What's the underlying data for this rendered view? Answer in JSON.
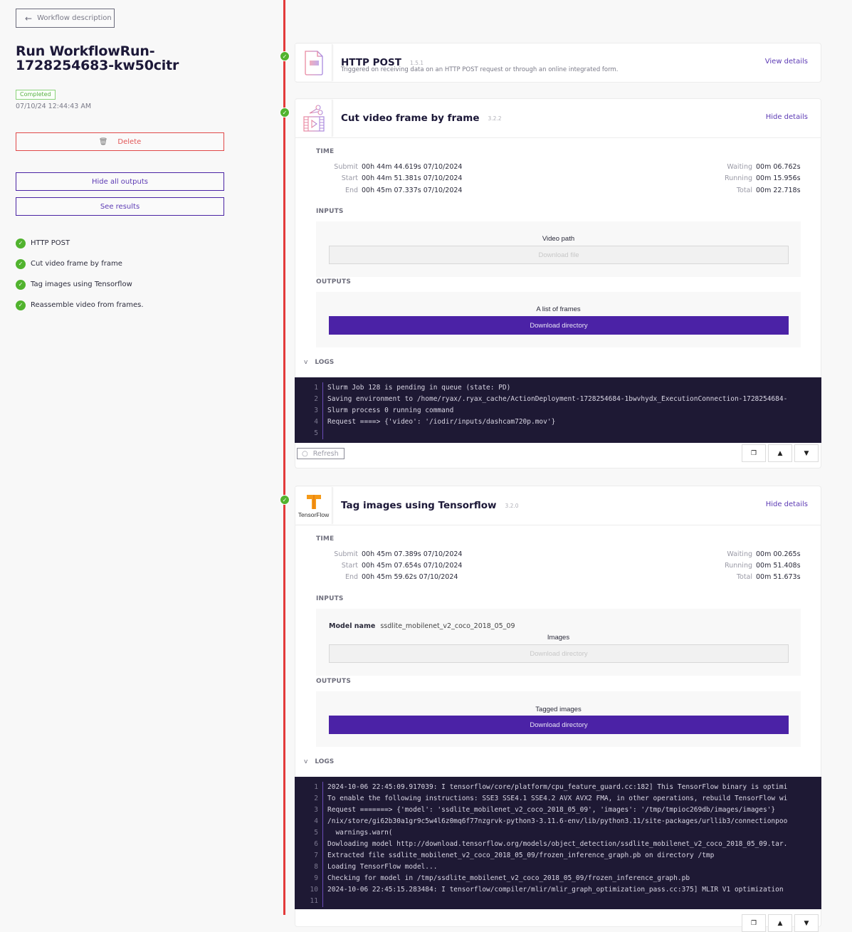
{
  "sidebar": {
    "back_label": "Workflow description",
    "run_title": "Run WorkflowRun-1728254683-kw50citr",
    "status": "Completed",
    "date": "07/10/24 12:44:43 AM",
    "delete_label": "Delete",
    "hide_outputs_label": "Hide all outputs",
    "see_results_label": "See results",
    "steps": [
      {
        "label": "HTTP POST",
        "status": "completed"
      },
      {
        "label": "Cut video frame by frame",
        "status": "completed"
      },
      {
        "label": "Tag images using Tensorflow",
        "status": "completed"
      },
      {
        "label": "Reassemble video from frames.",
        "status": "completed"
      }
    ]
  },
  "colors": {
    "accent": "#4b22a6",
    "timeline": "#e33b3b",
    "success": "#51b32e",
    "danger": "#e04848",
    "log_bg": "#1e1934"
  },
  "cards": [
    {
      "title": "HTTP POST",
      "version": "1.5.1",
      "description": "Triggered on receiving data on an HTTP POST request or through an online integrated form.",
      "link": "View details",
      "icon": "file-form-icon"
    },
    {
      "title": "Cut video frame by frame",
      "version": "3.2.2",
      "link": "Hide details",
      "icon": "video-scissors-icon",
      "time_label": "TIME",
      "times": {
        "submit_label": "Submit",
        "submit": "00h 44m 44.619s 07/10/2024",
        "start_label": "Start",
        "start": "00h 44m 51.381s 07/10/2024",
        "end_label": "End",
        "end": "00h 45m 07.337s 07/10/2024",
        "waiting_label": "Waiting",
        "waiting": "00m 06.762s",
        "running_label": "Running",
        "running": "00m 15.956s",
        "total_label": "Total",
        "total": "00m 22.718s"
      },
      "inputs_label": "INPUTS",
      "input_name": "Video path",
      "input_button": "Download file",
      "outputs_label": "OUTPUTS",
      "output_name": "A list of frames",
      "output_button": "Download directory",
      "logs_label": "LOGS",
      "logs": [
        {
          "n": "1",
          "text": "Slurm Job 128 is pending in queue (state: PD)"
        },
        {
          "n": "2",
          "text": "Saving environment to /home/ryax/.ryax_cache/ActionDeployment-1728254684-1bwvhydx_ExecutionConnection-1728254684-"
        },
        {
          "n": "3",
          "text": "Slurm process 0 running command"
        },
        {
          "n": "4",
          "text": "Request ====> {'video': '/iodir/inputs/dashcam720p.mov'}"
        },
        {
          "n": "5",
          "text": ""
        }
      ],
      "refresh_label": "Refresh"
    },
    {
      "title": "Tag images using Tensorflow",
      "version": "3.2.0",
      "link": "Hide details",
      "icon": "tensorflow-logo-icon",
      "icon_text": "TensorFlow",
      "time_label": "TIME",
      "times": {
        "submit_label": "Submit",
        "submit": "00h 45m 07.389s 07/10/2024",
        "start_label": "Start",
        "start": "00h 45m 07.654s 07/10/2024",
        "end_label": "End",
        "end": "00h 45m 59.62s 07/10/2024",
        "waiting_label": "Waiting",
        "waiting": "00m 00.265s",
        "running_label": "Running",
        "running": "00m 51.408s",
        "total_label": "Total",
        "total": "00m 51.673s"
      },
      "inputs_label": "INPUTS",
      "param_label": "Model name",
      "param_value": "ssdlite_mobilenet_v2_coco_2018_05_09",
      "input_name": "Images",
      "input_button": "Download directory",
      "outputs_label": "OUTPUTS",
      "output_name": "Tagged images",
      "output_button": "Download directory",
      "logs_label": "LOGS",
      "logs": [
        {
          "n": "1",
          "text": "2024-10-06 22:45:09.917039: I tensorflow/core/platform/cpu_feature_guard.cc:182] This TensorFlow binary is optimi"
        },
        {
          "n": "2",
          "text": "To enable the following instructions: SSE3 SSE4.1 SSE4.2 AVX AVX2 FMA, in other operations, rebuild TensorFlow wi"
        },
        {
          "n": "3",
          "text": "Request =======> {'model': 'ssdlite_mobilenet_v2_coco_2018_05_09', 'images': '/tmp/tmpioc269db/images/images'}"
        },
        {
          "n": "4",
          "text": "/nix/store/gi62b30a1gr9c5w4l6z0mq6f77nzgrvk-python3-3.11.6-env/lib/python3.11/site-packages/urllib3/connectionpoo"
        },
        {
          "n": "5",
          "text": "  warnings.warn("
        },
        {
          "n": "6",
          "text": "Dowloading model http://download.tensorflow.org/models/object_detection/ssdlite_mobilenet_v2_coco_2018_05_09.tar."
        },
        {
          "n": "7",
          "text": "Extracted file ssdlite_mobilenet_v2_coco_2018_05_09/frozen_inference_graph.pb on directory /tmp"
        },
        {
          "n": "8",
          "text": "Loading TensorFlow model..."
        },
        {
          "n": "9",
          "text": "Checking for model in /tmp/ssdlite_mobilenet_v2_coco_2018_05_09/frozen_inference_graph.pb"
        },
        {
          "n": "10",
          "text": "2024-10-06 22:45:15.283484: I tensorflow/compiler/mlir/mlir_graph_optimization_pass.cc:375] MLIR V1 optimization"
        },
        {
          "n": "11",
          "text": ""
        }
      ]
    }
  ]
}
